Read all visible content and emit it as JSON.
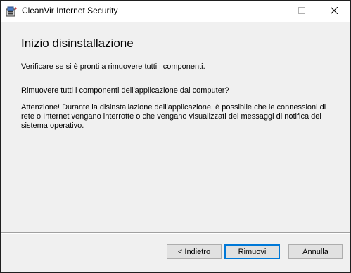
{
  "window": {
    "title": "CleanVir Internet Security",
    "controls": {
      "minimize_icon": "minimize-icon",
      "maximize_icon": "maximize-icon",
      "close_icon": "close-icon"
    }
  },
  "page": {
    "title": "Inizio disinstallazione",
    "subtitle": "Verificare se si è pronti a rimuovere tutti i componenti.",
    "question": "Rimuovere tutti i componenti dell'applicazione dal computer?",
    "warning": "Attenzione! Durante la disinstallazione dell'applicazione, è possibile che le connessioni di rete o Internet vengano interrotte o che vengano visualizzati dei messaggi di notifica del sistema operativo."
  },
  "buttons": {
    "back_label": "< Indietro",
    "remove_label": "Rimuovi",
    "cancel_label": "Annulla"
  },
  "colors": {
    "focus_border": "#0078d7",
    "dialog_background": "#f0f0f0",
    "titlebar_background": "#ffffff"
  }
}
